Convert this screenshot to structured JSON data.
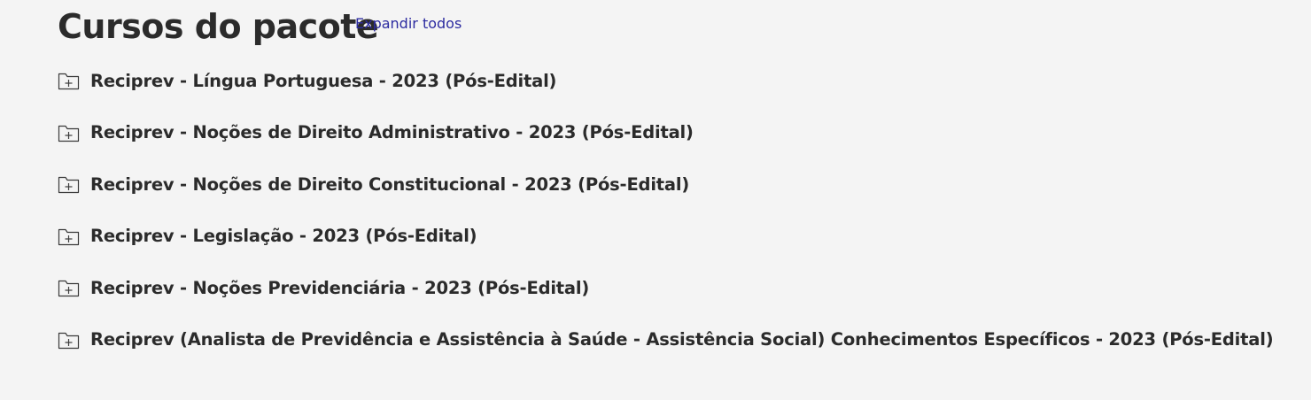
{
  "header": {
    "title": "Cursos do pacote",
    "expand_label": "Expandir todos"
  },
  "colors": {
    "background": "#f4f4f4",
    "text": "#2b2b2b",
    "link": "#2c2ba0"
  },
  "courses": [
    {
      "label": "Reciprev - Língua Portuguesa - 2023 (Pós-Edital)",
      "icon": "folder-plus-icon"
    },
    {
      "label": "Reciprev - Noções de Direito Administrativo - 2023 (Pós-Edital)",
      "icon": "folder-plus-icon"
    },
    {
      "label": "Reciprev - Noções de Direito Constitucional - 2023 (Pós-Edital)",
      "icon": "folder-plus-icon"
    },
    {
      "label": "Reciprev - Legislação - 2023 (Pós-Edital)",
      "icon": "folder-plus-icon"
    },
    {
      "label": "Reciprev - Noções Previdenciária - 2023 (Pós-Edital)",
      "icon": "folder-plus-icon"
    },
    {
      "label": "Reciprev (Analista de Previdência e Assistência à Saúde - Assistência Social) Conhecimentos Específicos - 2023 (Pós-Edital)",
      "icon": "folder-plus-icon"
    }
  ]
}
